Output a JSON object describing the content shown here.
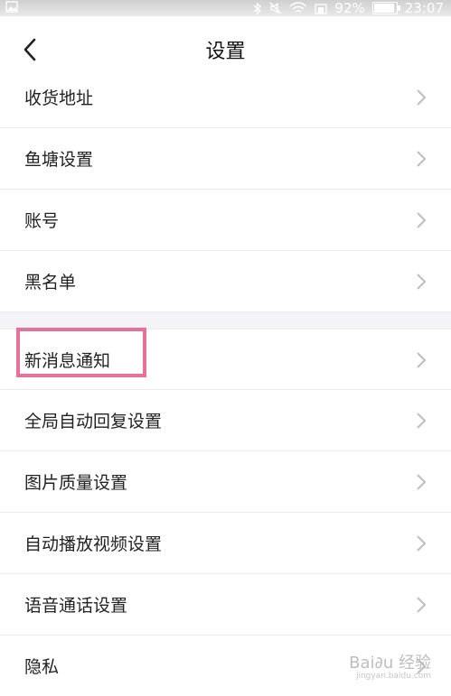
{
  "status_bar": {
    "battery_percent": "92%",
    "time": "23:07",
    "icons": [
      "bluetooth-icon",
      "mute-icon",
      "wifi-icon",
      "signal-icon",
      "battery-icon"
    ],
    "battery_level": 0.92
  },
  "nav": {
    "title": "设置",
    "back_icon": "chevron-left-icon"
  },
  "section1": [
    {
      "label": "收货地址"
    },
    {
      "label": "鱼塘设置"
    },
    {
      "label": "账号"
    },
    {
      "label": "黑名单"
    }
  ],
  "section2": [
    {
      "label": "新消息通知",
      "highlighted": true
    },
    {
      "label": "全局自动回复设置"
    },
    {
      "label": "图片质量设置"
    },
    {
      "label": "自动播放视频设置"
    },
    {
      "label": "语音通话设置"
    },
    {
      "label": "隐私"
    }
  ],
  "watermark": {
    "text": "Bai∂u 经验",
    "sub": "jingyan.baidu.com"
  },
  "colors": {
    "highlight": "#e8719a",
    "divider": "#ececec",
    "section_gap": "#f4f4f8"
  }
}
